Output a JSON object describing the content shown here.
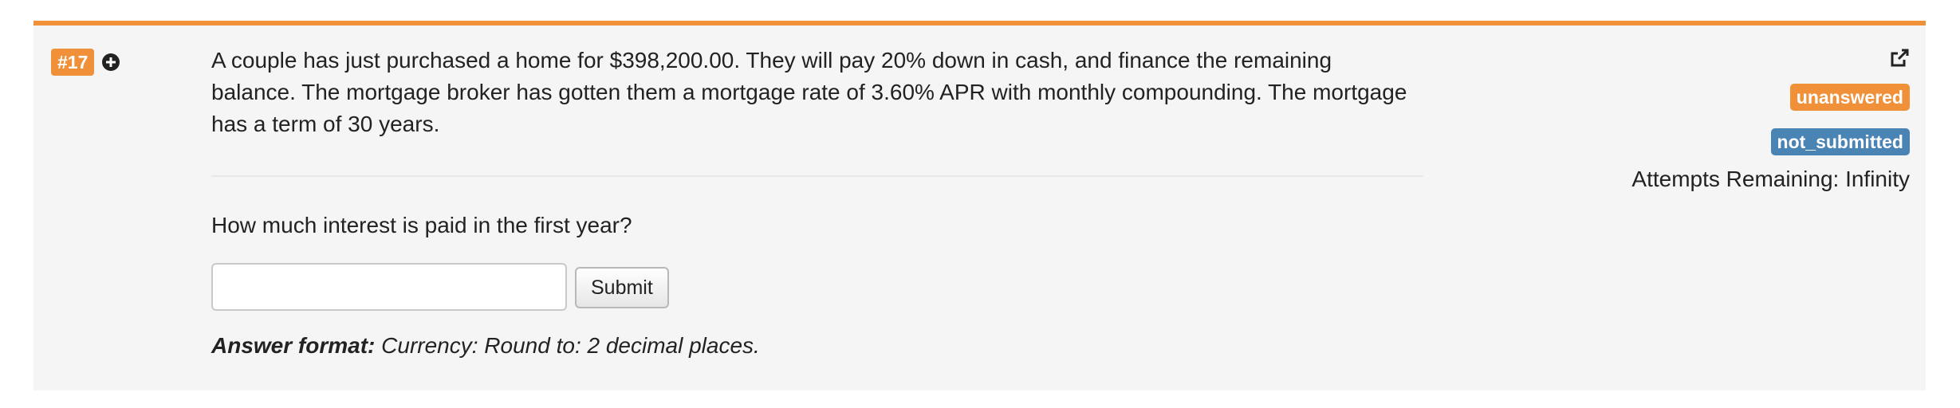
{
  "question": {
    "number": "#17",
    "problem_text": "A couple has just purchased a home for $398,200.00. They will pay 20% down in cash, and finance the remaining balance. The mortgage broker has gotten them a mortgage rate of 3.60% APR with monthly compounding. The mortgage has a term of 30 years.",
    "prompt": "How much interest is paid in the first year?",
    "answer_value": "",
    "answer_placeholder": "",
    "submit_label": "Submit",
    "format_label": "Answer format:",
    "format_text": " Currency: Round to: 2 decimal places."
  },
  "status": {
    "answer_badge": "unanswered",
    "submission_badge": "not_submitted",
    "attempts": "Attempts Remaining: Infinity"
  },
  "icons": {
    "expand": "plus-circle-icon",
    "share": "share-external-icon"
  },
  "colors": {
    "accent": "#f0913a",
    "info": "#4a84b4",
    "panel_bg": "#f5f5f5"
  }
}
